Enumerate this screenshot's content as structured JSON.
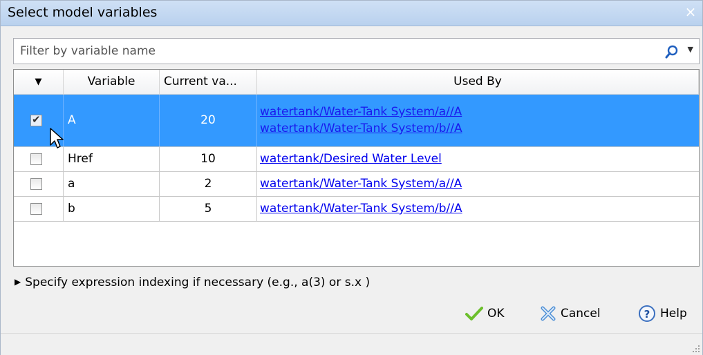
{
  "window": {
    "title": "Select model variables",
    "close_glyph": "×"
  },
  "filter": {
    "placeholder": "Filter by variable name",
    "value": "",
    "icon": "search-icon",
    "dropdown_glyph": "▼"
  },
  "table": {
    "sort_glyph": "▼",
    "columns": [
      "Variable",
      "Current va...",
      "Used By"
    ],
    "rows": [
      {
        "selected": true,
        "checked": true,
        "variable": "A",
        "value": "20",
        "used_by": [
          "watertank/Water-Tank System/a//A",
          "watertank/Water-Tank System/b//A"
        ]
      },
      {
        "selected": false,
        "checked": false,
        "variable": "Href",
        "value": "10",
        "used_by": [
          "watertank/Desired Water Level"
        ]
      },
      {
        "selected": false,
        "checked": false,
        "variable": "a",
        "value": "2",
        "used_by": [
          "watertank/Water-Tank System/a//A"
        ]
      },
      {
        "selected": false,
        "checked": false,
        "variable": "b",
        "value": "5",
        "used_by": [
          "watertank/Water-Tank System/b//A"
        ]
      }
    ]
  },
  "expander": {
    "label": "Specify expression indexing if necessary (e.g., a(3) or s.x )",
    "glyph": "▶"
  },
  "buttons": {
    "ok": "OK",
    "cancel": "Cancel",
    "help": "Help"
  },
  "colors": {
    "selection": "#3399ff",
    "link": "#0000ee",
    "title_bar": "#c4d8f1",
    "ok_check": "#6cbf2c",
    "cancel_icon": "#4d8fd6",
    "help_icon": "#3a6fbf"
  }
}
